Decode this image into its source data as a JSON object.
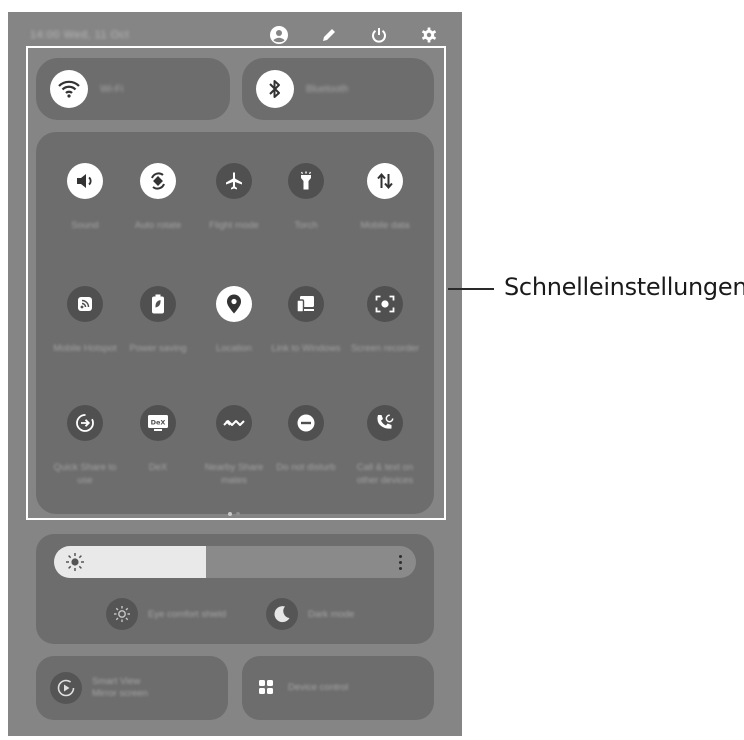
{
  "status_bar": {
    "datetime": "14:00 Wed, 11 Oct",
    "icons": [
      "profile-icon",
      "edit-icon",
      "power-icon",
      "settings-icon"
    ]
  },
  "top_toggles": [
    {
      "label": "Wi-Fi",
      "icon": "wifi-icon",
      "state": "on"
    },
    {
      "label": "Bluetooth",
      "icon": "bluetooth-icon",
      "state": "on"
    }
  ],
  "quick_settings": [
    {
      "label": "Sound",
      "icon": "volume-icon",
      "state": "on"
    },
    {
      "label": "Auto rotate",
      "icon": "auto-rotate-icon",
      "state": "on"
    },
    {
      "label": "Flight mode",
      "icon": "airplane-icon",
      "state": "off"
    },
    {
      "label": "Torch",
      "icon": "flashlight-icon",
      "state": "off"
    },
    {
      "label": "Mobile data",
      "icon": "mobile-data-icon",
      "state": "on"
    },
    {
      "label": "Mobile Hotspot",
      "icon": "hotspot-icon",
      "state": "off"
    },
    {
      "label": "Power saving",
      "icon": "battery-icon",
      "state": "off"
    },
    {
      "label": "Location",
      "icon": "location-icon",
      "state": "on"
    },
    {
      "label": "Link to Windows",
      "icon": "link-windows-icon",
      "state": "off"
    },
    {
      "label": "Screen recorder",
      "icon": "screen-recorder-icon",
      "state": "off"
    },
    {
      "label": "Quick Share to use",
      "icon": "quick-share-icon",
      "state": "off"
    },
    {
      "label": "DeX",
      "icon": "dex-icon",
      "state": "off"
    },
    {
      "label": "Nearby Share mates",
      "icon": "nearby-share-icon",
      "state": "off"
    },
    {
      "label": "Do not disturb",
      "icon": "do-not-disturb-icon",
      "state": "off"
    },
    {
      "label": "Call & text on other devices",
      "icon": "call-text-icon",
      "state": "off"
    }
  ],
  "pager": {
    "current": 1,
    "total": 2
  },
  "brightness": {
    "level": 0.42
  },
  "display_modes": [
    {
      "label": "Eye comfort shield",
      "icon": "eye-comfort-icon"
    },
    {
      "label": "Dark mode",
      "icon": "dark-mode-icon"
    }
  ],
  "bottom_cards": [
    {
      "title": "Smart View",
      "subtitle": "Mirror screen",
      "icon": "smart-view-icon"
    },
    {
      "title": "Device control",
      "subtitle": "",
      "icon": "device-control-icon"
    }
  ],
  "callout": {
    "label": "Schnelleinstellungen"
  },
  "colors": {
    "panel": "#858585",
    "card": "#6d6d6d",
    "active": "#ffffff",
    "inactive": "#505050"
  }
}
